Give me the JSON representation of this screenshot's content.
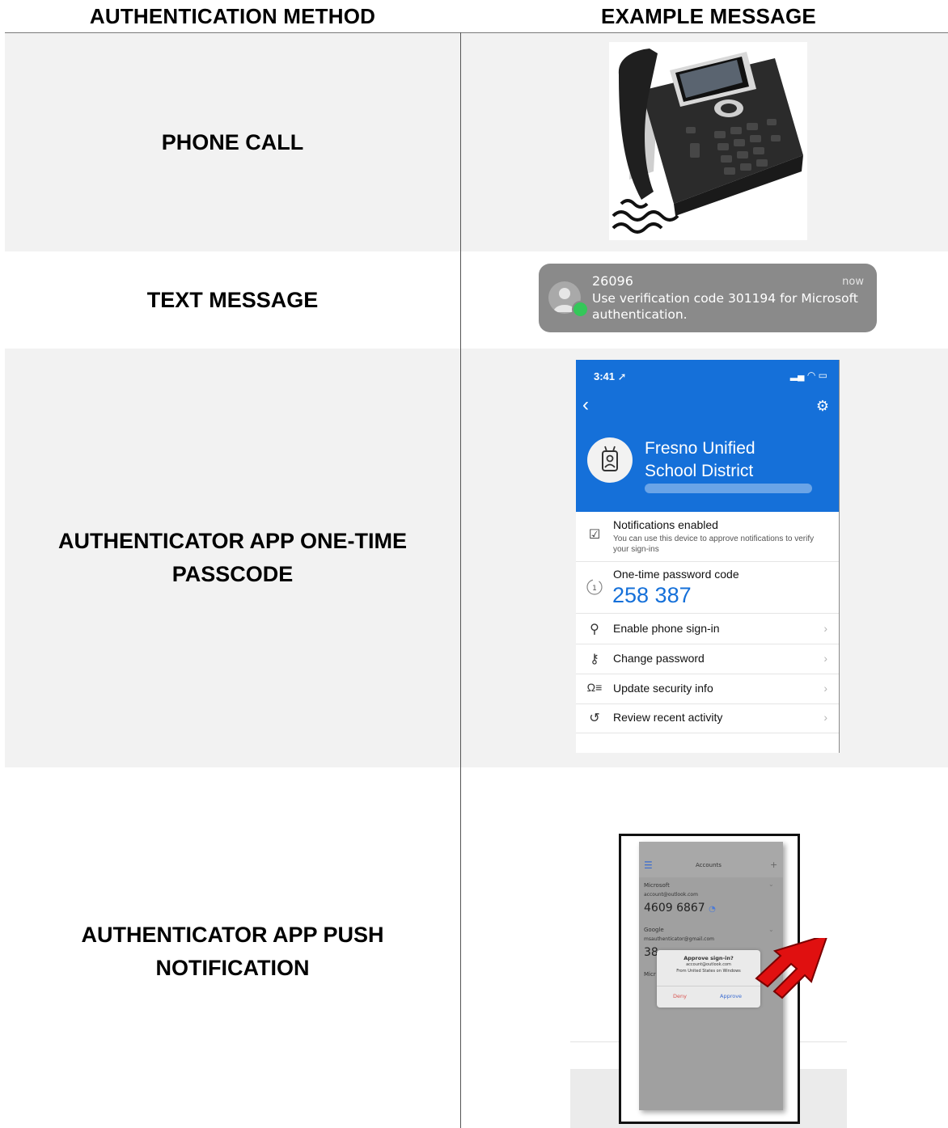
{
  "header": {
    "col1": "AUTHENTICATION METHOD",
    "col2": "EXAMPLE MESSAGE"
  },
  "rows": [
    {
      "label": "PHONE CALL"
    },
    {
      "label": "TEXT MESSAGE"
    },
    {
      "label_line1": "AUTHENTICATOR APP ONE-TIME",
      "label_line2": "PASSCODE"
    },
    {
      "label_line1": "AUTHENTICATOR APP PUSH",
      "label_line2": "NOTIFICATION"
    }
  ],
  "sms": {
    "sender": "26096",
    "time": "now",
    "body": "Use verification code 301194 for Microsoft authentication."
  },
  "app": {
    "status_time": "3:41",
    "org_line1": "Fresno Unified",
    "org_line2": "School District",
    "items": [
      {
        "title": "Notifications enabled",
        "subtitle": "You can use this device to approve notifications to verify your sign-ins",
        "icon": "notification-check-icon"
      },
      {
        "title": "One-time password code",
        "code": "258 387",
        "icon": "timer-icon"
      },
      {
        "title": "Enable phone sign-in",
        "icon": "phone-signin-icon"
      },
      {
        "title": "Change password",
        "icon": "key-icon"
      },
      {
        "title": "Update security info",
        "icon": "security-info-icon"
      },
      {
        "title": "Review recent activity",
        "icon": "history-icon"
      }
    ]
  },
  "push": {
    "header_title": "Accounts",
    "account1_name": "Microsoft",
    "account1_email": "account@outlook.com",
    "account1_code": "4609 6867",
    "account2_name": "Google",
    "account2_email": "msauthenticator@gmail.com",
    "account2_code_partial": "38",
    "account3_name_partial": "Micr",
    "dialog_title": "Approve sign-in?",
    "dialog_email": "account@outlook.com",
    "dialog_location": "From United States on Windows",
    "deny_label": "Deny",
    "approve_label": "Approve"
  },
  "colors": {
    "row_gray": "#f2f2f2",
    "app_blue": "#1570d9",
    "sms_gray": "#8a8a8a",
    "arrow_red": "#e01010"
  }
}
